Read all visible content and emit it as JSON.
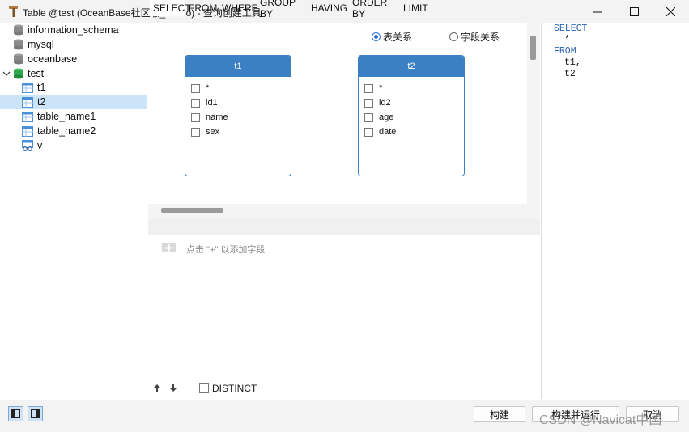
{
  "window": {
    "title": "Table @test (OceanBase社区版_Demo) - 查询创建工具"
  },
  "sidebar": {
    "items": [
      {
        "label": "information_schema",
        "icon": "database-icon"
      },
      {
        "label": "mysql",
        "icon": "database-icon"
      },
      {
        "label": "oceanbase",
        "icon": "database-icon"
      },
      {
        "label": "test",
        "icon": "database-icon",
        "expanded": true
      },
      {
        "label": "t1",
        "icon": "table-icon"
      },
      {
        "label": "t2",
        "icon": "table-icon",
        "selected": true
      },
      {
        "label": "table_name1",
        "icon": "table-icon"
      },
      {
        "label": "table_name2",
        "icon": "table-icon"
      },
      {
        "label": "v",
        "icon": "view-icon"
      }
    ]
  },
  "canvas": {
    "relation_options": [
      "表关系",
      "字段关系"
    ],
    "selected_relation": "表关系",
    "tables": [
      {
        "name": "t1",
        "fields": [
          "*",
          "id1",
          "name",
          "sex"
        ]
      },
      {
        "name": "t2",
        "fields": [
          "*",
          "id2",
          "age",
          "date"
        ]
      }
    ]
  },
  "tabs": [
    "SELECT",
    "FROM",
    "WHERE",
    "GROUP BY",
    "HAVING",
    "ORDER BY",
    "LIMIT"
  ],
  "active_tab": "SELECT",
  "select_panel": {
    "add_hint": "点击 \"+\" 以添加字段",
    "distinct_label": "DISTINCT",
    "distinct_checked": false
  },
  "sql": {
    "line1": "SELECT",
    "line2": "*",
    "line3": "FROM",
    "line4": "t1,",
    "line5": "t2"
  },
  "footer": {
    "build_label": "构建",
    "build_run_label": "构建并运行",
    "cancel_label": "取消",
    "watermark": "CSDN @Navicat中国"
  },
  "colors": {
    "accent": "#3a80c3",
    "sql_keyword": "#2d64b4",
    "selected_bg": "#cce4f7"
  }
}
